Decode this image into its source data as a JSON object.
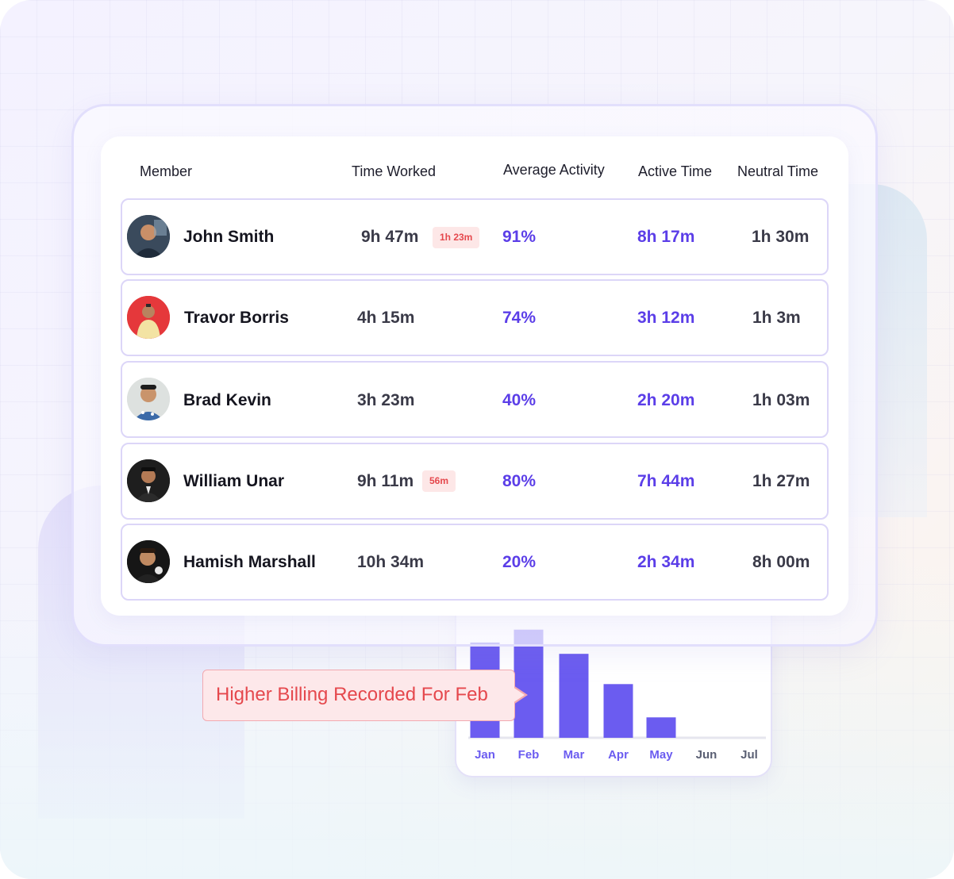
{
  "table": {
    "headers": {
      "member": "Member",
      "time_worked": "Time Worked",
      "average_activity": "Average Activity",
      "active_time": "Active Time",
      "neutral_time": "Neutral Time"
    },
    "rows": [
      {
        "name": "John Smith",
        "time_worked": "9h 47m",
        "badge": "1h 23m",
        "average_activity": "91%",
        "active_time": "8h 17m",
        "neutral_time": "1h 30m"
      },
      {
        "name": "Travor Borris",
        "time_worked": "4h 15m",
        "badge": "",
        "average_activity": "74%",
        "active_time": "3h 12m",
        "neutral_time": "1h 3m"
      },
      {
        "name": "Brad Kevin",
        "time_worked": "3h 23m",
        "badge": "",
        "average_activity": "40%",
        "active_time": "2h 20m",
        "neutral_time": "1h 03m"
      },
      {
        "name": "William Unar",
        "time_worked": "9h 11m",
        "badge": "56m",
        "average_activity": "80%",
        "active_time": "7h 44m",
        "neutral_time": "1h 27m"
      },
      {
        "name": "Hamish Marshall",
        "time_worked": "10h 34m",
        "badge": "",
        "average_activity": "20%",
        "active_time": "2h 34m",
        "neutral_time": "8h 00m"
      }
    ]
  },
  "tooltip": {
    "text": "Higher Billing Recorded For Feb"
  },
  "colors": {
    "accent": "#5b3ee8",
    "bar": "#6b5cf0",
    "badge_bg": "#fde7e7",
    "badge_text": "#e5484d",
    "month_active": "#6b5cf0",
    "month_inactive": "#5a5f73"
  },
  "chart_data": {
    "type": "bar",
    "categories": [
      "Jan",
      "Feb",
      "Mar",
      "Apr",
      "May",
      "Jun",
      "Jul"
    ],
    "values": [
      126,
      143,
      111,
      71,
      27,
      0,
      0
    ],
    "title": "",
    "xlabel": "",
    "ylabel": "",
    "ylim": [
      0,
      150
    ],
    "grid": false,
    "legend": "none"
  }
}
